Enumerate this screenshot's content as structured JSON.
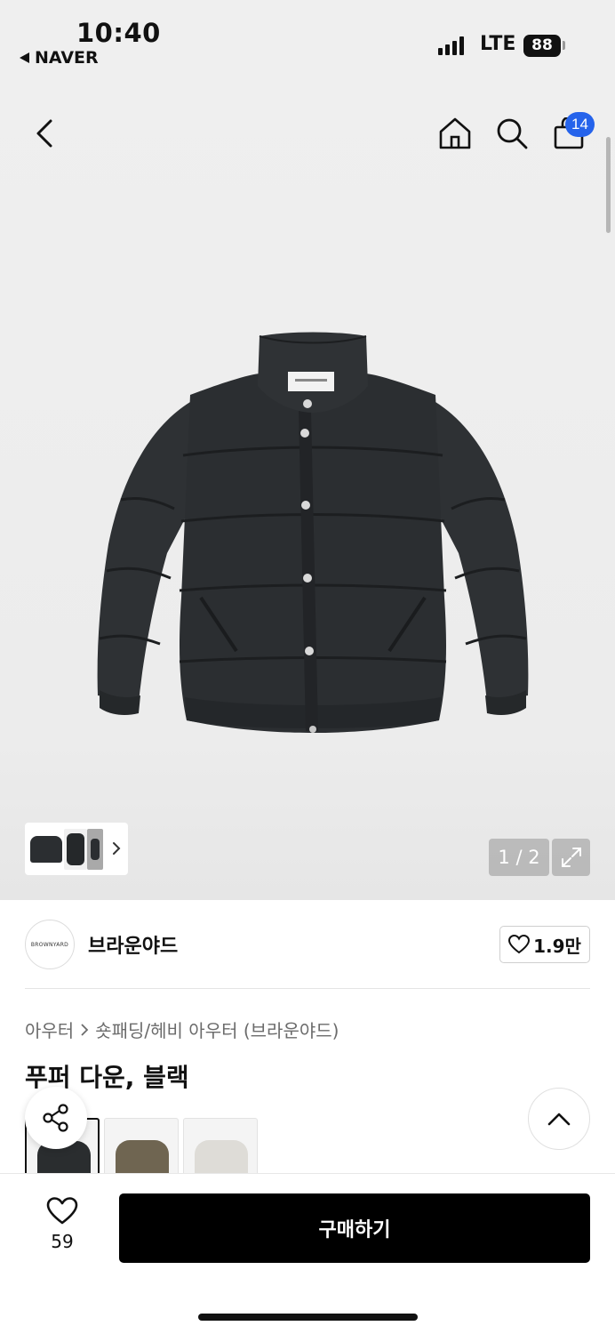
{
  "status_bar": {
    "time": "10:40",
    "back_app": "NAVER",
    "network": "LTE",
    "battery": "88"
  },
  "header": {
    "cart_count": "14"
  },
  "gallery": {
    "page_counter": "1 / 2",
    "thumbnail_count": 3
  },
  "brand": {
    "logo_text": "BROWNYARD",
    "name": "브라운야드",
    "likes": "1.9만"
  },
  "breadcrumb": {
    "level1": "아우터",
    "level2": "숏패딩/헤비 아우터 (브라운야드)"
  },
  "product": {
    "title": "푸퍼 다운, 블랙",
    "variants": [
      {
        "color": "#2a2d2f",
        "selected": true
      },
      {
        "color": "#6f6551",
        "selected": false
      },
      {
        "color": "#dedcd7",
        "selected": false
      }
    ]
  },
  "bottom_bar": {
    "wish_count": "59",
    "buy_label": "구매하기"
  },
  "colors": {
    "cart_badge": "#2563eb",
    "buy_button": "#000000",
    "jacket": "#2b2e31"
  },
  "icons": [
    "back-icon",
    "home-icon",
    "search-icon",
    "cart-icon",
    "share-icon",
    "chevron-up-icon",
    "heart-icon",
    "expand-icon"
  ]
}
